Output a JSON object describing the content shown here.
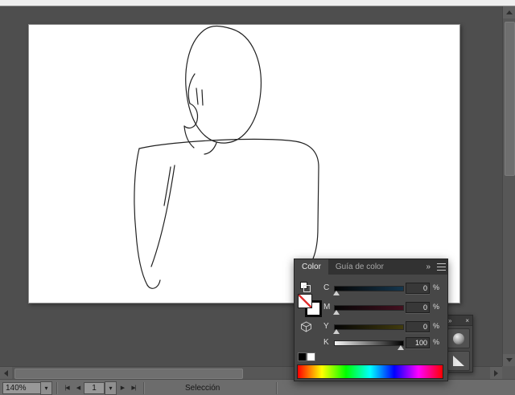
{
  "colors": {
    "canvas_bg": "#4e4e4e",
    "artboard_bg": "#ffffff",
    "panel_bg": "#474747",
    "panel_header_bg": "#323232",
    "status_bar_bg": "#6c6c6c",
    "sketch_stroke": "#222222"
  },
  "status_bar": {
    "zoom": "140%",
    "zoom_dropdown_icon": "▾",
    "nav_first": "|◀",
    "nav_prev": "◀",
    "artboard_number": "1",
    "artboard_dropdown_icon": "▾",
    "nav_next": "▶",
    "nav_last": "▶|",
    "status": "Selección"
  },
  "color_panel": {
    "tabs": [
      {
        "label": "Color",
        "active": true
      },
      {
        "label": "Guía de color",
        "active": false
      }
    ],
    "collapse_icon": "»",
    "sliders": [
      {
        "channel": "C",
        "value": "0",
        "unit": "%",
        "percent": 0,
        "gradient": [
          "#050505",
          "#15364d"
        ]
      },
      {
        "channel": "M",
        "value": "0",
        "unit": "%",
        "percent": 0,
        "gradient": [
          "#050505",
          "#43101f"
        ]
      },
      {
        "channel": "Y",
        "value": "0",
        "unit": "%",
        "percent": 0,
        "gradient": [
          "#050505",
          "#413b0e"
        ]
      },
      {
        "channel": "K",
        "value": "100",
        "unit": "%",
        "percent": 100,
        "gradient": [
          "#f5f5f5",
          "#000000"
        ]
      }
    ],
    "spectrum_colors": [
      "#ff0000",
      "#ffff00",
      "#00ff00",
      "#00ffff",
      "#0000ff",
      "#ff00ff",
      "#ff0000"
    ]
  },
  "mini_panel": {
    "collapse_icon": "»",
    "close_icon": "×"
  }
}
